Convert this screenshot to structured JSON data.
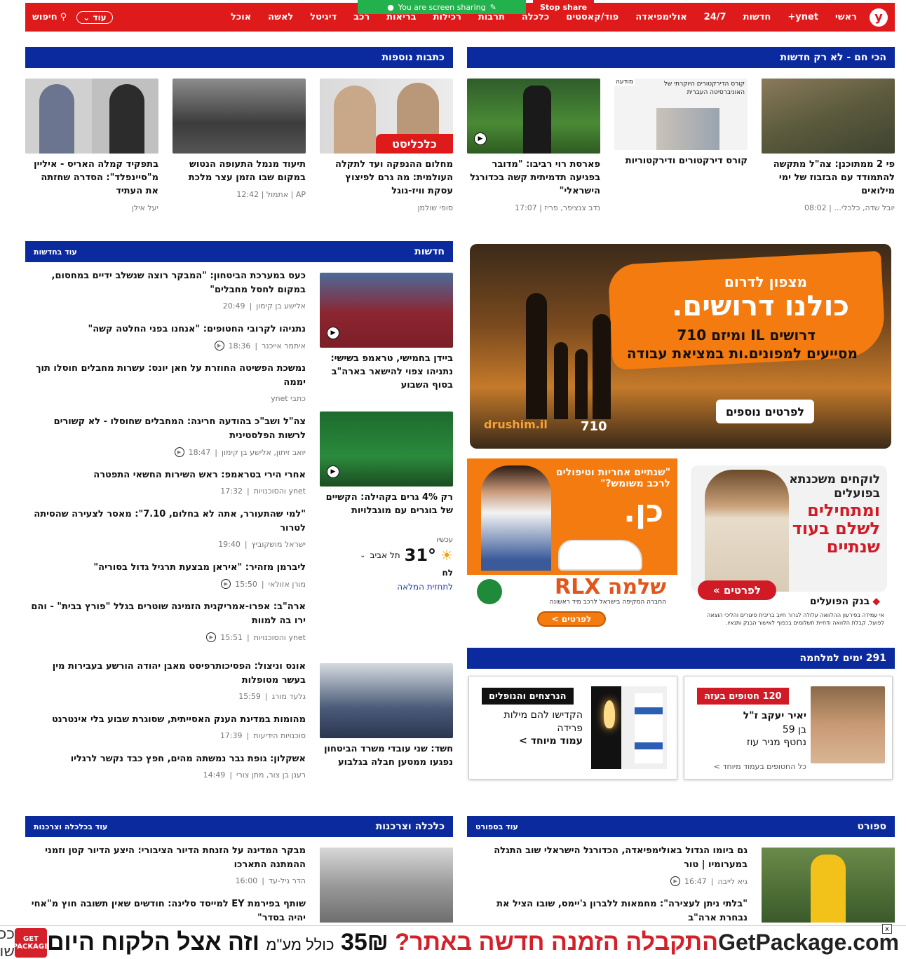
{
  "nav": {
    "logo": "y",
    "items": [
      "ראשי",
      "ynet+",
      "חדשות",
      "24/7",
      "אולימפיאדה",
      "פוד/קאסטים",
      "כלכלה",
      "תרבות",
      "רכילות",
      "בריאות",
      "רכב",
      "דיגיטל",
      "לאשה",
      "אוכל"
    ],
    "more": "עוד",
    "search": "חיפוש"
  },
  "screen_share": {
    "text": "You are screen sharing",
    "stop": "Stop share"
  },
  "hot": {
    "header": "הכי חם - לא רק חדשות",
    "cards": [
      {
        "title": "פי 2 ממתוכנן: צה\"ל מתקשה להתמודד עם הבזבוז של ימי מילואים",
        "author": "יובל שדה, כלכלי...",
        "time": "08:02"
      },
      {
        "title": "קורס דירקטורים ודירקטוריות",
        "ad_label": "מודעה",
        "ad_text": "קורס הדירקטורים היוקרתי של האוניברסיטה העברית"
      },
      {
        "title": "פארסת רוי רביבו: \"מדובר בפגיעה תדמיתית קשה בכדורגל הישראלי\"",
        "author": "נדב צנציפר, פריז",
        "time": "17:07"
      }
    ]
  },
  "more_articles": {
    "header": "כתבות נוספות",
    "cards": [
      {
        "title": "מחלום ההנפקה ועד לתקלה העולמית: מה גרם לפיצוץ עסקת וויז-גוגל",
        "author": "סופי שולמן",
        "badge": "כלכליסט"
      },
      {
        "title": "תיעוד מנמל התעופה הנטוש במקום שבו הזמן עצר מלכת",
        "author": "AP",
        "source": "אתמול",
        "time": "12:42"
      },
      {
        "title": "בתפקיד קמלה האריס - איליין מ\"סיינפלד\": הסדרה שחזתה את העתיד",
        "author": "יעל אילן"
      }
    ]
  },
  "news": {
    "header": "חדשות",
    "more": "עוד בחדשות",
    "featured": [
      {
        "title": "ביידן בחמישי, טראמפ בשישי: נתניהו צפוי להישאר בארה\"ב בסוף השבוע"
      },
      {
        "title": "רק 4% גרים בקהילה: הקשיים של בוגרים עם מוגבלויות"
      },
      {
        "title": "חשד: שני עובדי משרד הביטחון נפגעו ממטען חבלה בגלבוע"
      }
    ],
    "items": [
      {
        "title": "כעס במערכת הביטחון: \"המבקר רוצה שנשלב ידיים במחסום, במקום לחסל מחבלים\"",
        "author": "אלישע בן קימון",
        "time": "20:49"
      },
      {
        "title": "נתניהו לקרובי החטופים: \"אנחנו בפני החלטה קשה\"",
        "author": "איתמר אייכנר",
        "time": "18:36"
      },
      {
        "title": "נמשכת הפשיטה החוזרת על חאן יונס: עשרות מחבלים חוסלו תוך יממה",
        "author": "כתבי ynet",
        "time": ""
      },
      {
        "title": "צה\"ל ושב\"כ בהודעה חריגה: המחבלים שחוסלו - לא קשורים לרשות הפלסטינית",
        "author": "יואב זיתון, אלישע בן קימון",
        "time": "18:47"
      },
      {
        "title": "אחרי הירי בטראמפ: ראש השירות החשאי התפטרה",
        "author": "ynet והסוכנויות",
        "time": "17:32"
      },
      {
        "title": "\"למי שהתעורר, אתה לא בחלום, 7.10\": מאסר לצעירה שהסיתה לטרור",
        "author": "ישראל מושקוביץ",
        "time": "19:40"
      },
      {
        "title": "ליברמן מזהיר: \"איראן מבצעת תרגיל גדול בסוריה\"",
        "author": "מורן אזולאי",
        "time": "15:50"
      },
      {
        "title": "ארה\"ב: אפרו-אמריקנית הזמינה שוטרים בגלל \"פורץ בבית\" - והם ירו בה למוות",
        "author": "ynet והסוכנויות",
        "time": "15:51"
      },
      {
        "title": "אונס וניצול: הפסיכותרפיסט מאבן יהודה הורשע בעבירות מין בעשר מטופלות",
        "author": "גלעד מורג",
        "time": "15:59"
      },
      {
        "title": "מהומות במדינת הענק האסייתית, שסוגרת שבוע בלי אינטרנט",
        "author": "סוכנויות הידיעות",
        "time": "17:39"
      },
      {
        "title": "אשקלון: גופת גבר נמשתה מהים, חפץ כבד נקשר לרגליו",
        "author": "רענן בן צור, מתן צורי",
        "time": "14:49"
      }
    ]
  },
  "weather": {
    "now": "עכשיו",
    "temp": "31°",
    "city": "תל אביב",
    "humid": "לח",
    "link": "לתחזית המלאה"
  },
  "ads": {
    "drushim": {
      "top": "מצפון לדרום",
      "main": "כולנו דרושים.",
      "sub1": "דרושים IL ומיזם 710",
      "sub2": "מסייעים למפונים.ות במציאת עבודה",
      "btn": "לפרטים נוספים",
      "brand": "drushim.il",
      "num": "710"
    },
    "bank": {
      "l1": "לוקחים משכנתא",
      "l2": "בפועלים",
      "l3": "ומתחילים",
      "l4": "לשלם בעוד",
      "l5": "שנתיים",
      "btn": "לפרטים »",
      "brand": "בנק הפועלים",
      "fine": "אי עמידה בפירעון ההלוואה עלולה לגרור חיוב בריבית פיגורים והליכי הוצאה לפועל. קבלת הלוואה ודחיית תשלומים בכפוף לאישור הבנק ותנאיו."
    },
    "shlomo": {
      "quote": "\"שנתיים אחריות וטיפולים לרכב משומש?\"",
      "big": "כן.",
      "brand": "שלמה RLX",
      "sub": "החברה המקיפה בישראל לרכב מיד ראשונה",
      "btn": "לפרטים >"
    }
  },
  "war": {
    "header": "291 ימים למלחמה",
    "hostage": {
      "badge": "120 חטופים בעזה",
      "name": "יאיר יעקב ז\"ל",
      "age": "בן 59",
      "place": "נחטף מניר עוז",
      "link": "כל החטופים בעמוד מיוחד >"
    },
    "fallen": {
      "badge": "הנרצחים והנופלים",
      "text": "הקדישו להם מילות פרידה",
      "link": "עמוד מיוחד >"
    }
  },
  "sport": {
    "header": "ספורט",
    "more": "עוד בספורט",
    "items": [
      {
        "title": "גם ביומו הגדול באולימפיאדה, הכדורגל הישראלי שוב התגלה במערומיו | טור",
        "author": "גיא לייבה",
        "time": "16:47"
      },
      {
        "title": "\"בלתי ניתן לעצירה\": מחמאות ללברון ג'יימס, שובו הציל את נבחרת ארה\"ב"
      }
    ]
  },
  "economy": {
    "header": "כלכלה וצרכנות",
    "more": "עוד בכלכלה וצרכנות",
    "items": [
      {
        "title": "מבקר המדינה על הזנחת הדיור הציבורי: היצע הדיור קטן וזמני ההמתנה התארכו",
        "author": "הדר גיל-עד",
        "time": "16:00"
      },
      {
        "title": "שותף בפירמת EY למייסד סלינה: חודשים שאין תשובה חוץ מ\"אחי יהיה בסדר\""
      }
    ]
  },
  "bottom_ad": {
    "brand": "GetPackage.com",
    "q": "התקבלה הזמנה חדשה באתר?",
    "price": "35₪",
    "incl": "כולל מע\"מ",
    "tail": "וזה אצל הלקוח היום",
    "logo": "GET PACKAGE",
    "partial": "ככה שולחי",
    "close": "x"
  }
}
